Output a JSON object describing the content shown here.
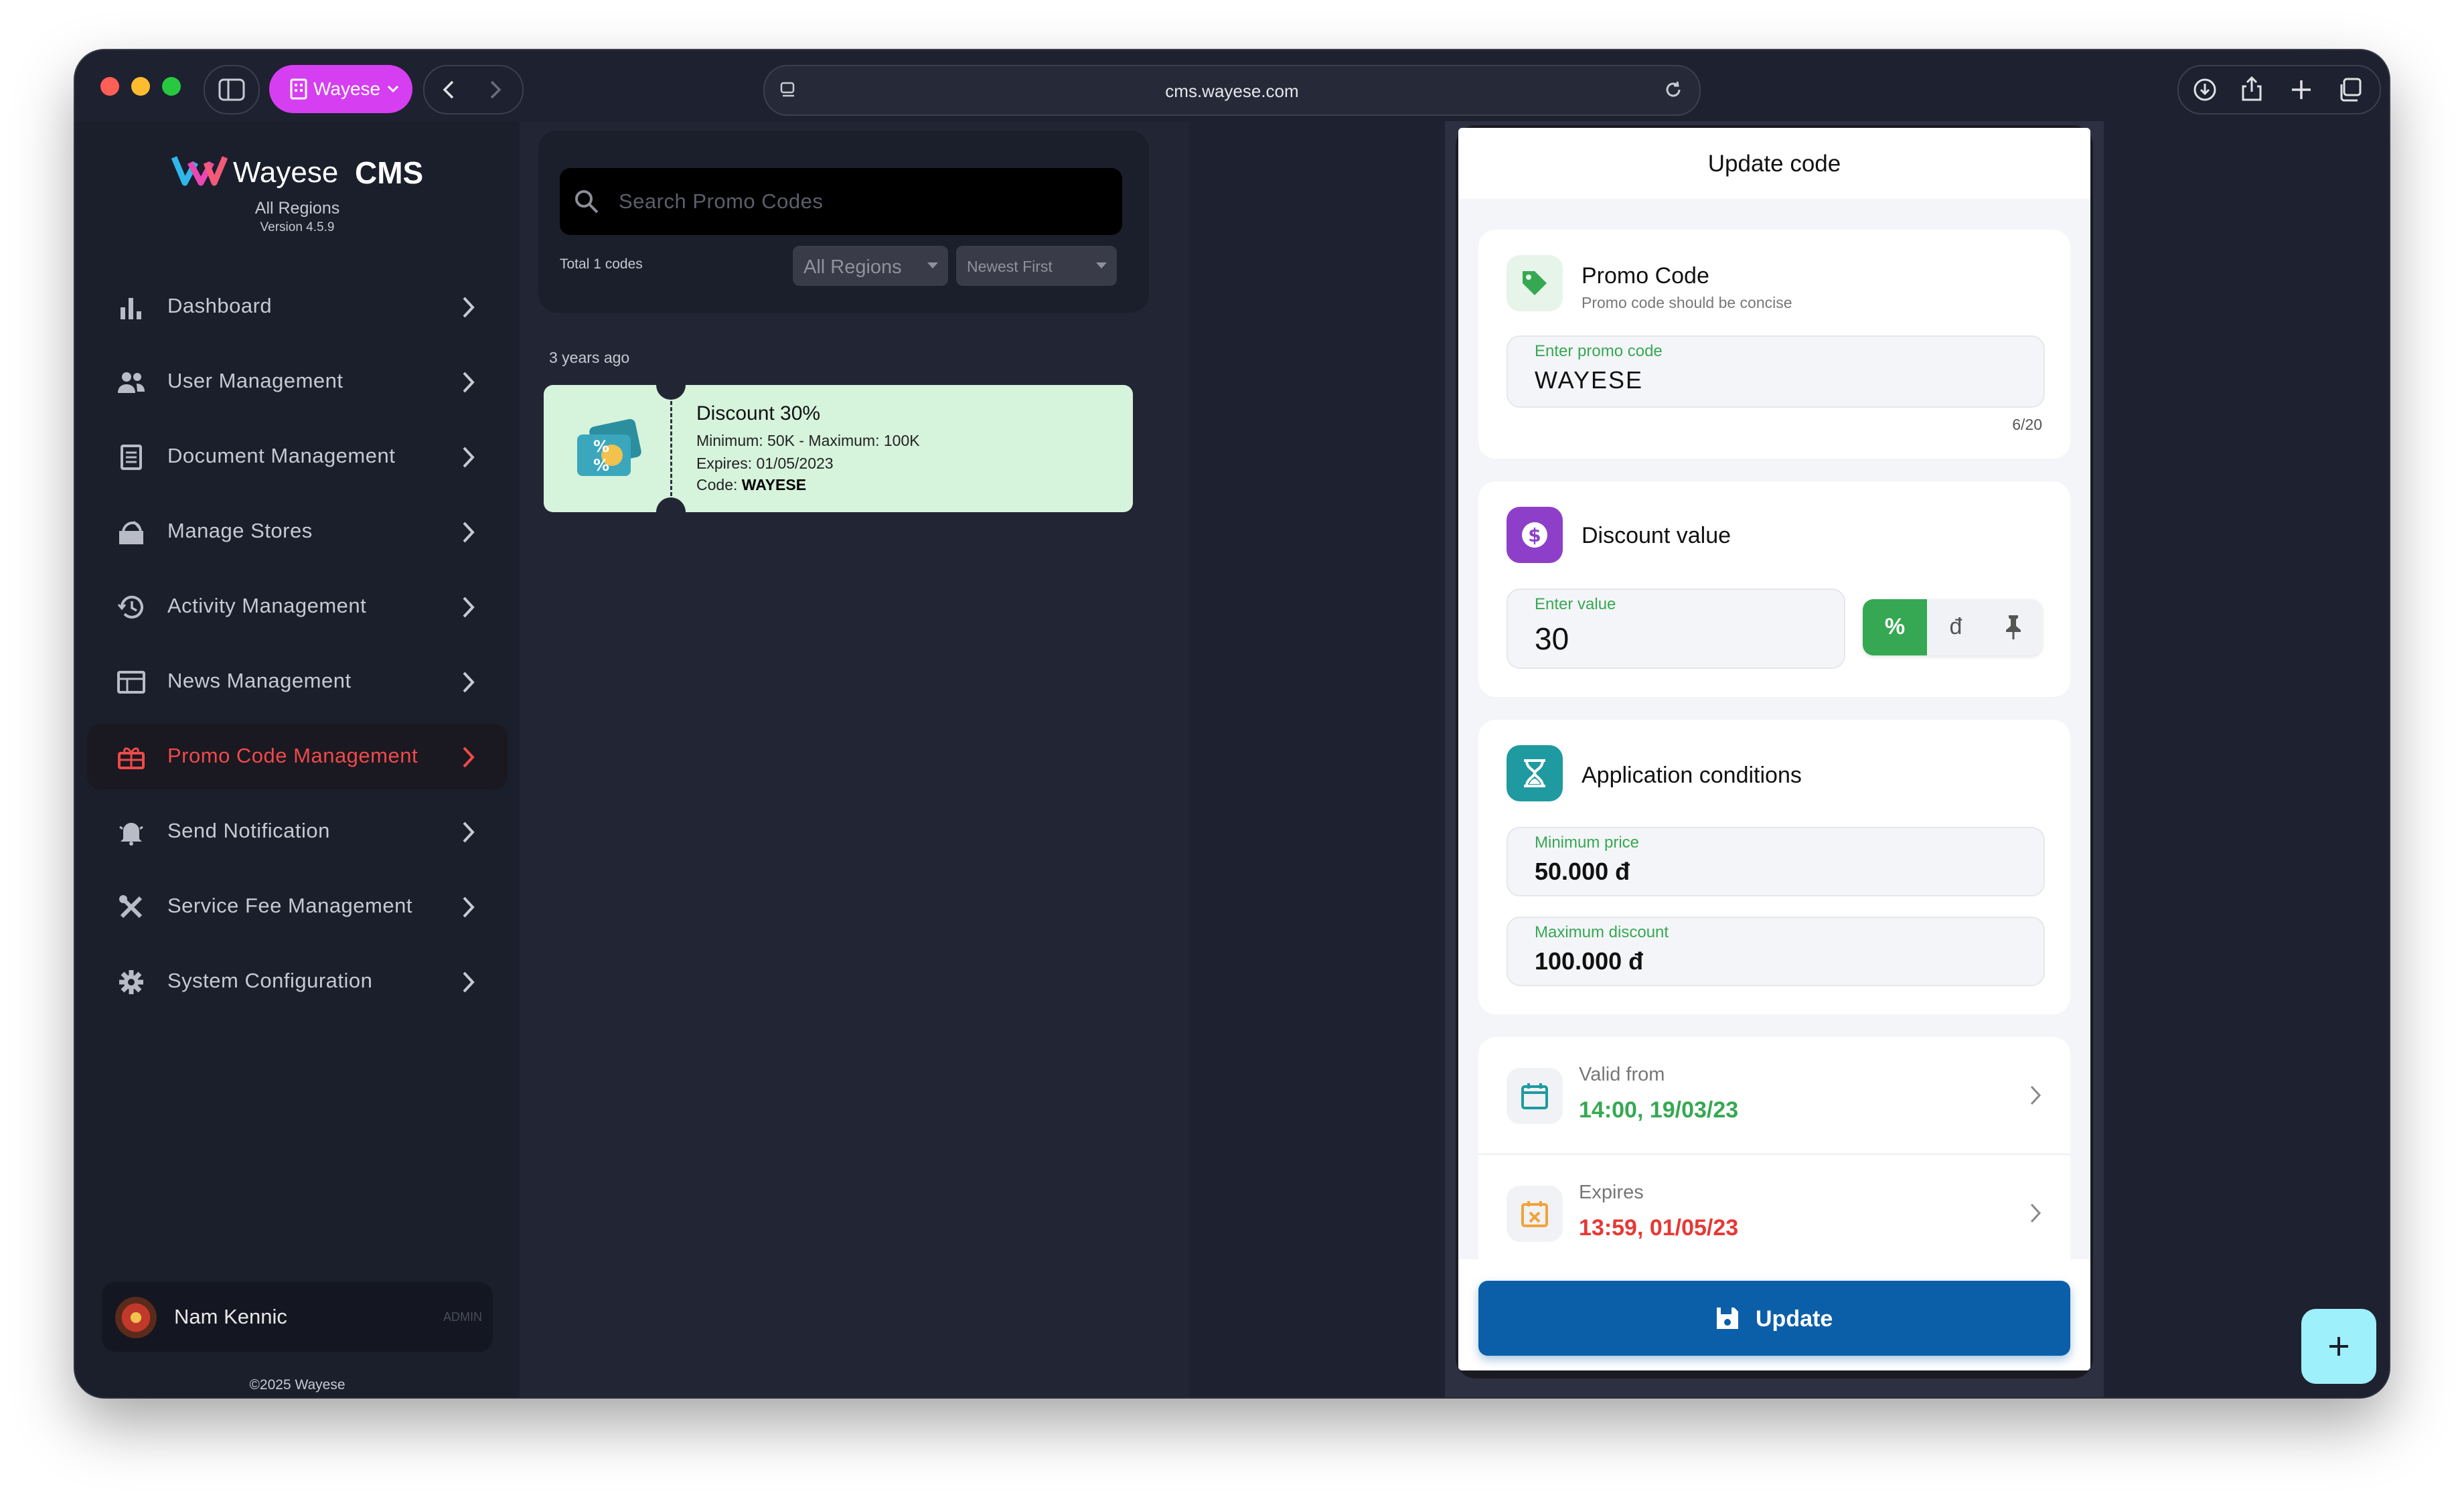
{
  "browser": {
    "profile_label": "Wayese",
    "url": "cms.wayese.com"
  },
  "brand": {
    "name": "Wayese",
    "product": "CMS",
    "region": "All Regions",
    "version": "Version 4.5.9"
  },
  "sidebar": {
    "items": [
      {
        "label": "Dashboard",
        "icon": "bar-chart-icon"
      },
      {
        "label": "User Management",
        "icon": "users-icon"
      },
      {
        "label": "Document Management",
        "icon": "document-icon"
      },
      {
        "label": "Manage Stores",
        "icon": "store-icon"
      },
      {
        "label": "Activity Management",
        "icon": "history-icon"
      },
      {
        "label": "News Management",
        "icon": "news-icon"
      },
      {
        "label": "Promo Code Management",
        "icon": "gift-icon",
        "active": true
      },
      {
        "label": "Send Notification",
        "icon": "bell-icon"
      },
      {
        "label": "Service Fee Management",
        "icon": "tools-icon"
      },
      {
        "label": "System Configuration",
        "icon": "gear-icon"
      }
    ],
    "user": {
      "name": "Nam Kennic",
      "role": "ADMIN"
    },
    "copyright": "©2025 Wayese"
  },
  "list": {
    "search_placeholder": "Search Promo Codes",
    "total": "Total 1 codes",
    "region_filter": "All Regions",
    "sort": "Newest First",
    "group_label": "3 years ago",
    "promo": {
      "title": "Discount 30%",
      "limits": "Minimum: 50K - Maximum: 100K",
      "expires": "Expires: 01/05/2023",
      "code_prefix": "Code: ",
      "code": "WAYESE"
    }
  },
  "editor": {
    "title": "Update code",
    "promo_code": {
      "title": "Promo Code",
      "subtitle": "Promo code should be concise",
      "field_label": "Enter promo code",
      "value": "WAYESE",
      "counter": "6/20"
    },
    "discount": {
      "title": "Discount value",
      "field_label": "Enter value",
      "value": "30",
      "unit_percent": "%",
      "unit_currency": "đ"
    },
    "conditions": {
      "title": "Application conditions",
      "min_label": "Minimum price",
      "min_value": "50.000 đ",
      "max_label": "Maximum discount",
      "max_value": "100.000 đ"
    },
    "dates": {
      "valid_from_label": "Valid from",
      "valid_from_value": "14:00, 19/03/23",
      "expires_label": "Expires",
      "expires_value": "13:59, 01/05/23"
    },
    "update_button": "Update"
  },
  "colors": {
    "accent_active": "#ef4a4a",
    "green": "#36a853",
    "purple": "#8e3fc9",
    "teal": "#1f9aa0",
    "update_blue": "#0b5fa8",
    "red_date": "#e53935"
  }
}
